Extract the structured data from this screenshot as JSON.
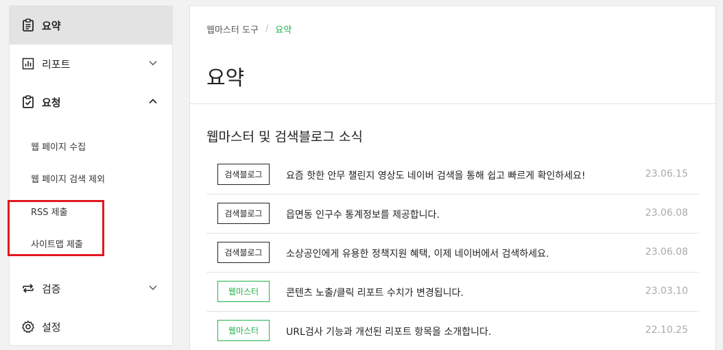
{
  "sidebar": {
    "summary": {
      "label": "요약",
      "icon": "clipboard-icon"
    },
    "report": {
      "label": "리포트",
      "icon": "bar-chart-icon"
    },
    "request": {
      "label": "요청",
      "icon": "clipboard-check-icon"
    },
    "request_sub": [
      {
        "label": "웹 페이지 수집"
      },
      {
        "label": "웹 페이지 검색 제외"
      },
      {
        "label": "RSS 제출"
      },
      {
        "label": "사이트맵 제출"
      }
    ],
    "verify": {
      "label": "검증",
      "icon": "sync-arrows-icon"
    },
    "settings": {
      "label": "설정",
      "icon": "gear-icon"
    }
  },
  "breadcrumb": {
    "root": "웹마스터 도구",
    "separator": "/",
    "current": "요약"
  },
  "page_title": "요약",
  "news_section": {
    "title": "웹마스터 및 검색블로그 소식",
    "items": [
      {
        "badge": "검색블로그",
        "text": "요즘 핫한 안무 챌린지 영상도 네이버 검색을 통해 쉽고 빠르게 확인하세요!",
        "date": "23.06.15"
      },
      {
        "badge": "검색블로그",
        "text": "읍면동 인구수 통계정보를 제공합니다.",
        "date": "23.06.08"
      },
      {
        "badge": "검색블로그",
        "text": "소상공인에게 유용한 정책지원 혜택, 이제 네이버에서 검색하세요.",
        "date": "23.06.08"
      },
      {
        "badge": "웹마스터",
        "text": "콘텐츠 노출/클릭 리포트 수치가 변경됩니다.",
        "date": "23.03.10"
      },
      {
        "badge": "웹마스터",
        "text": "URL검사 기능과 개선된 리포트 항목을 소개합니다.",
        "date": "22.10.25"
      }
    ]
  },
  "colors": {
    "accent_green": "#22b14c",
    "highlight_red": "#e3171d",
    "active_bg": "#e3e3e3"
  }
}
